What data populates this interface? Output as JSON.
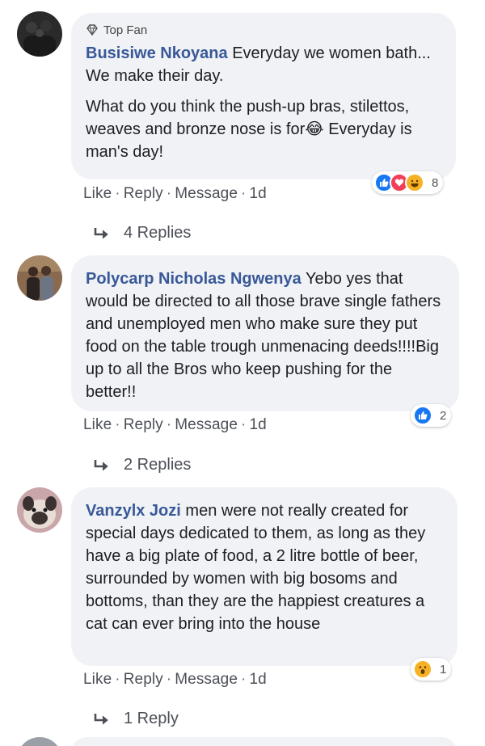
{
  "comments": [
    {
      "badge": "Top Fan",
      "author": "Busisiwe Nkoyana",
      "text_first": "Everyday we women bath... We make their day.",
      "text_second": "What do you think the push-up bras, stilettos, weaves and bronze nose is for😂 Everyday is man's day!",
      "reactions": [
        "like",
        "love",
        "haha"
      ],
      "reaction_count": "8",
      "actions": {
        "like": "Like",
        "reply": "Reply",
        "message": "Message",
        "age": "1d"
      },
      "replies_label": "4 Replies"
    },
    {
      "author": "Polycarp Nicholas Ngwenya",
      "text_first": "Yebo yes that would be directed to all those brave single fathers and unemployed men who make sure they put food on the table trough unmenacing deeds!!!!Big up to all the Bros who keep pushing for the better!!",
      "reactions": [
        "like"
      ],
      "reaction_count": "2",
      "actions": {
        "like": "Like",
        "reply": "Reply",
        "message": "Message",
        "age": "1d"
      },
      "replies_label": "2 Replies"
    },
    {
      "author": "Vanzylx Jozi",
      "text_first": "men were not really created for special days dedicated to them, as long as they have a big plate of food, a 2 litre bottle of beer, surrounded by women with big bosoms and bottoms, than they are the happiest creatures a cat can ever bring into the house",
      "reactions": [
        "wow"
      ],
      "reaction_count": "1",
      "actions": {
        "like": "Like",
        "reply": "Reply",
        "message": "Message",
        "age": "1d"
      },
      "replies_label": "1 Reply"
    }
  ],
  "colors": {
    "author": "#385898",
    "bubble": "#f0f2f5",
    "like_blue": "#1877f2",
    "love_red": "#f33e58",
    "haha_yellow": "#f7b125"
  }
}
